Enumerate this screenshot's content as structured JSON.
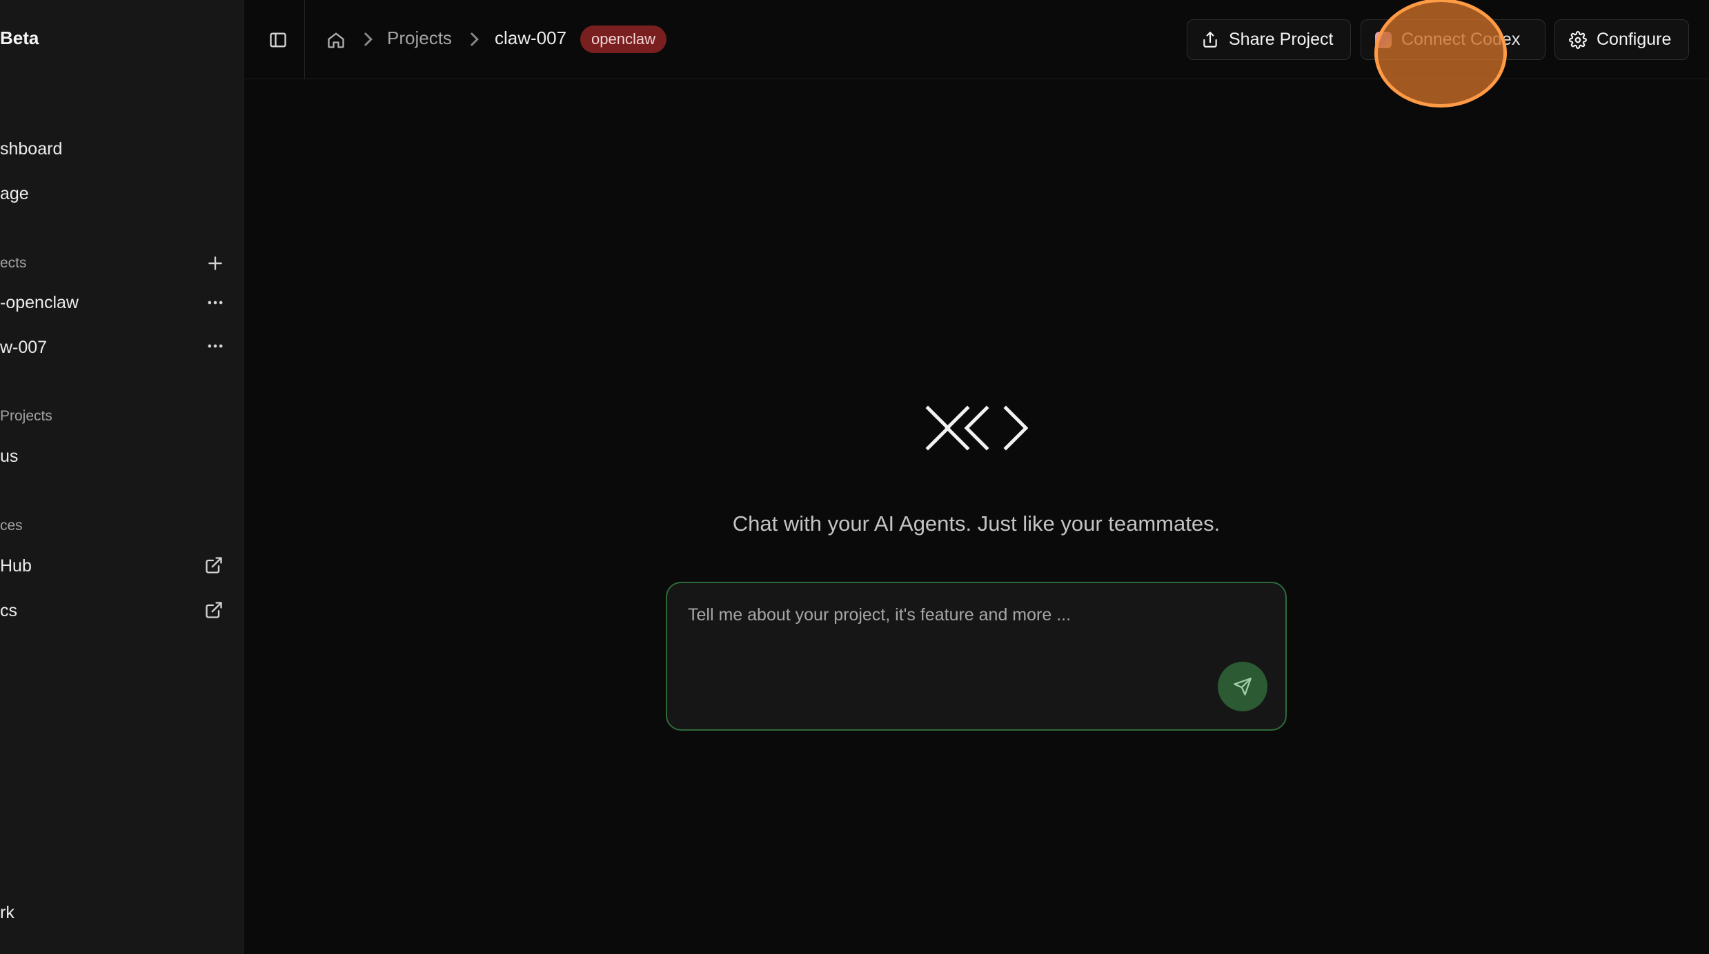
{
  "sidebar": {
    "brand": "Beta",
    "nav": [
      {
        "label": "shboard"
      },
      {
        "label": "age"
      }
    ],
    "projects_section": "ects",
    "projects": [
      {
        "label": "-openclaw"
      },
      {
        "label": "w-007"
      }
    ],
    "shared_section": "Projects",
    "shared": [
      {
        "label": "us"
      }
    ],
    "resources_section": "ces",
    "resources": [
      {
        "label": "Hub"
      },
      {
        "label": "cs"
      }
    ],
    "footer": "rk"
  },
  "topbar": {
    "breadcrumb": {
      "projects": "Projects",
      "current": "claw-007",
      "tag": "openclaw"
    },
    "share_label": "Share Project",
    "connect_label": "Connect Codex",
    "configure_label": "Configure"
  },
  "main": {
    "tagline": "Chat with your AI Agents. Just like your teammates.",
    "chat_placeholder": "Tell me about your project, it's feature and more ..."
  }
}
